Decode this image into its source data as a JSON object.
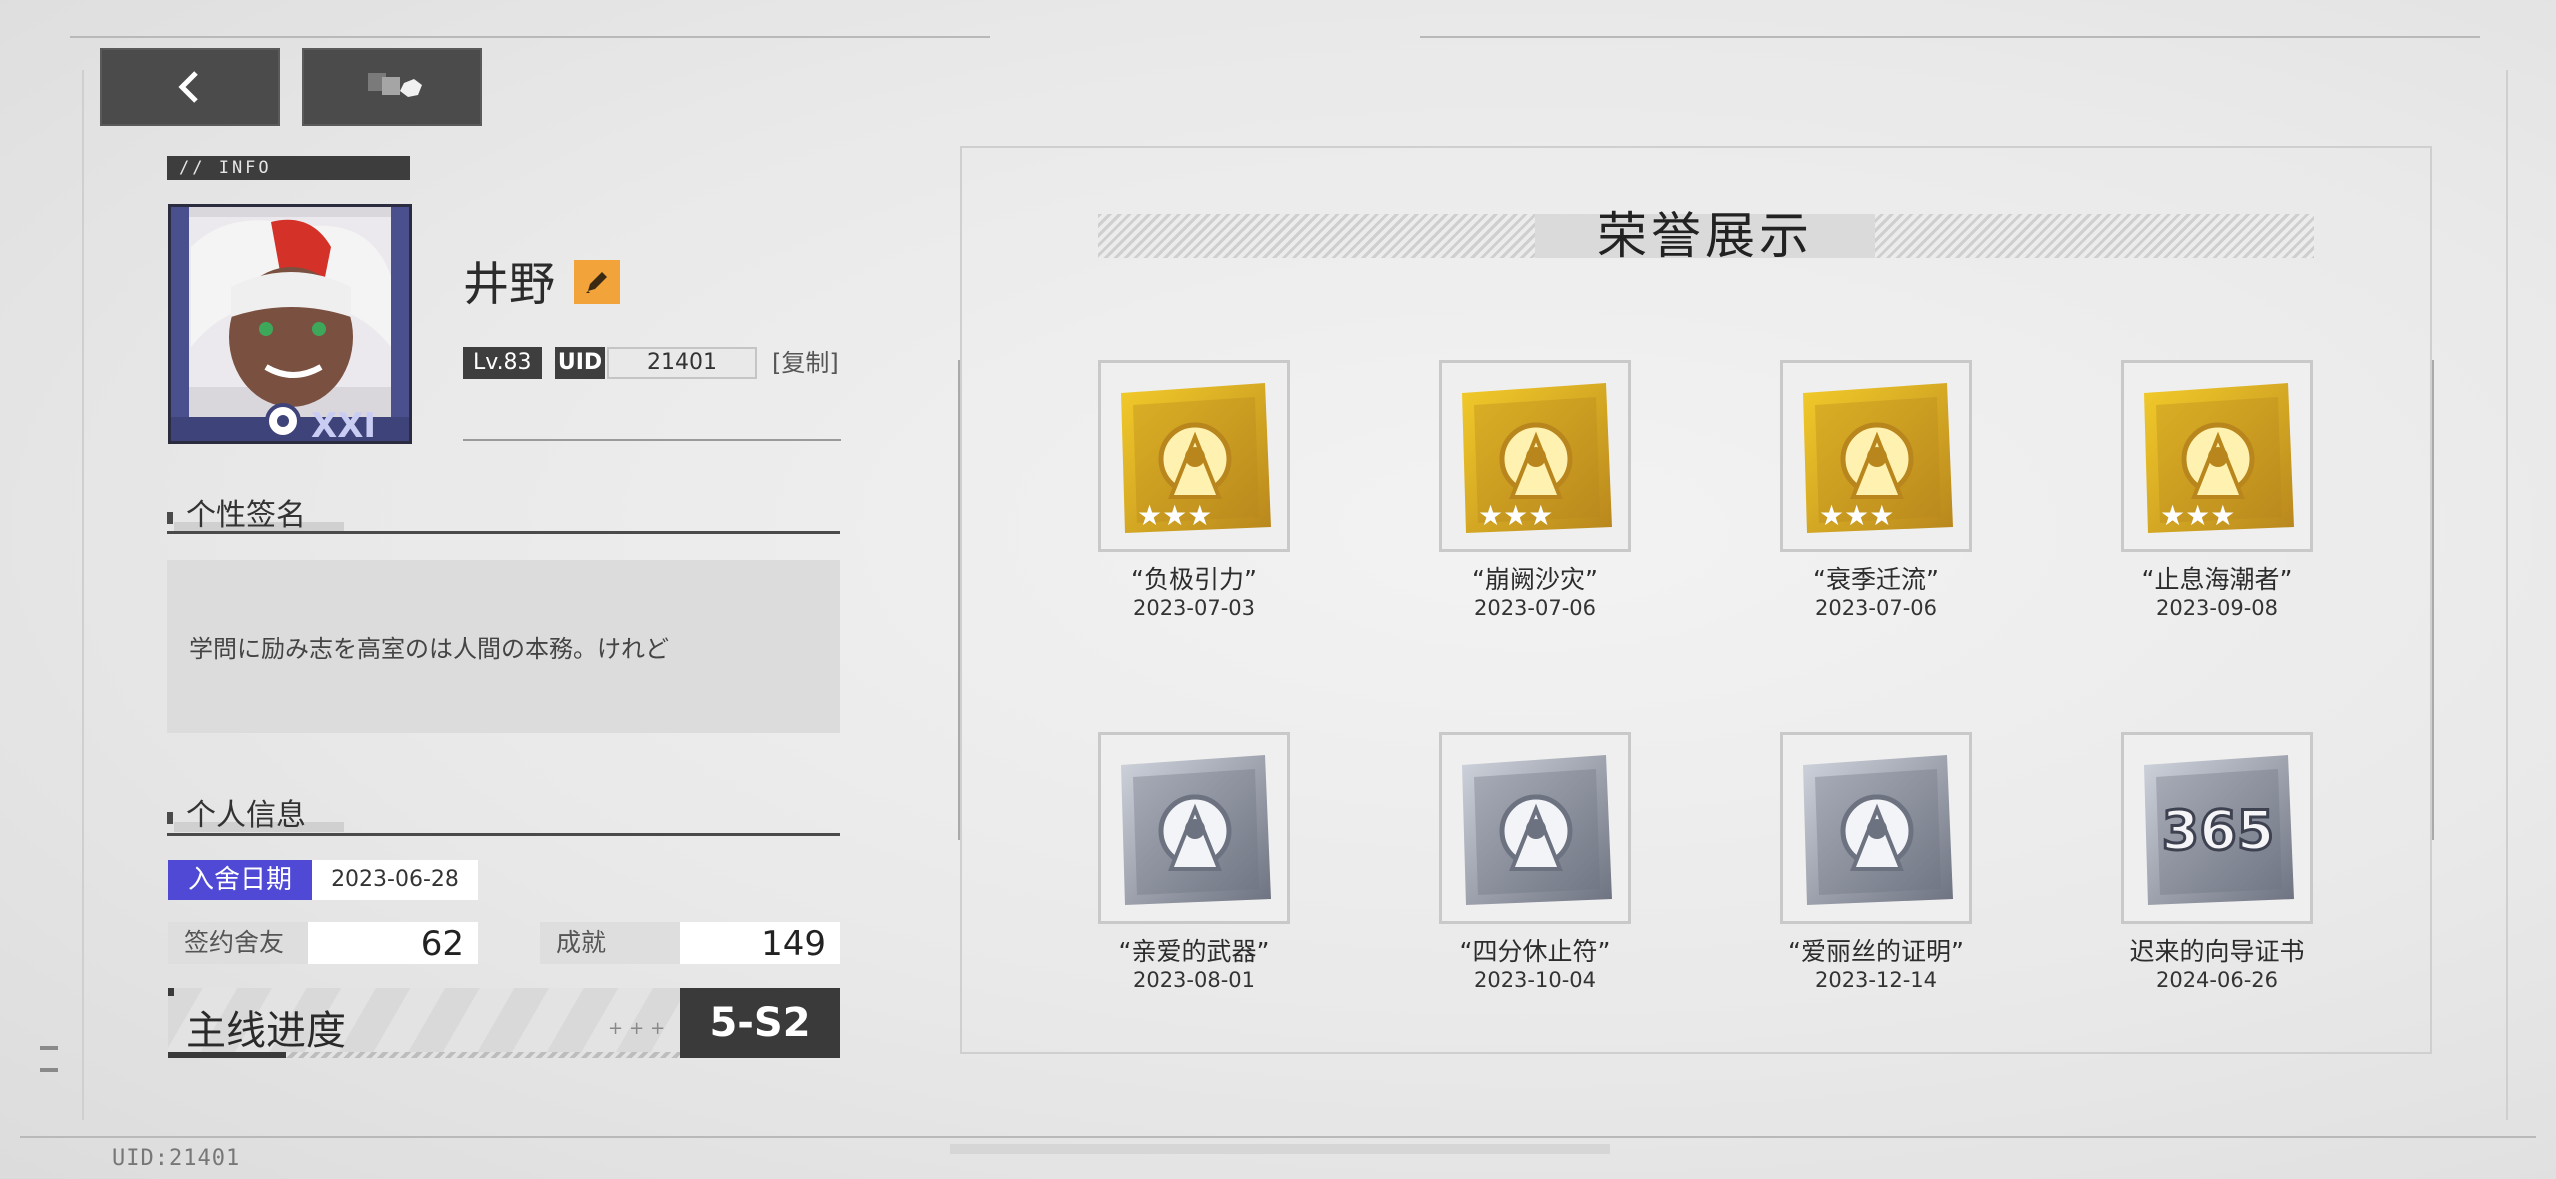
{
  "header": {
    "back_icon": "chevron-left-icon",
    "switch_icon": "cubes-icon"
  },
  "info_tag": "// INFO",
  "profile": {
    "name": "井野",
    "level": "Lv.83",
    "uid_label": "UID",
    "uid_value": "21401",
    "copy_label": "[复制]"
  },
  "signature": {
    "title": "个性签名",
    "text": "学問に励み志を高室のは人間の本務。けれど"
  },
  "personal_info": {
    "title": "个人信息",
    "join_label": "入舍日期",
    "join_date": "2023-06-28",
    "contract_label": "签约舍友",
    "contract_value": "62",
    "achieve_label": "成就",
    "achieve_value": "149",
    "progress_label": "主线进度",
    "progress_plus": "+++",
    "progress_value": "5-S2",
    "progress_fraction": 0.23
  },
  "honors": {
    "title": "荣誉展示",
    "items": [
      {
        "name": "“负极引力”",
        "date": "2023-07-03",
        "tier": "gold"
      },
      {
        "name": "“崩阙沙灾”",
        "date": "2023-07-06",
        "tier": "gold"
      },
      {
        "name": "“衰季迁流”",
        "date": "2023-07-06",
        "tier": "gold"
      },
      {
        "name": "“止息海潮者”",
        "date": "2023-09-08",
        "tier": "gold"
      },
      {
        "name": "“亲爱的武器”",
        "date": "2023-08-01",
        "tier": "silver"
      },
      {
        "name": "“四分休止符”",
        "date": "2023-10-04",
        "tier": "silver"
      },
      {
        "name": "“爱丽丝的证明”",
        "date": "2023-12-14",
        "tier": "silver"
      },
      {
        "name": "迟来的向导证书",
        "date": "2024-06-26",
        "tier": "silver",
        "badge_text": "365"
      }
    ]
  },
  "footer_uid": "UID:21401",
  "colors": {
    "accent_purple": "#4f49d6",
    "edit_orange": "#f2a33a",
    "dark": "#3a3a3a"
  }
}
